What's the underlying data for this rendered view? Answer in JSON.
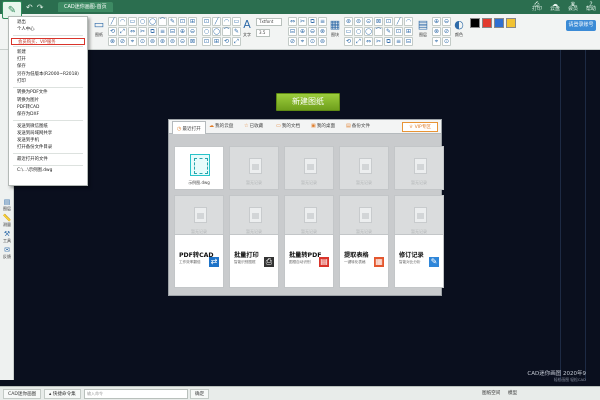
{
  "titlebar": {
    "tab_title": "CAD迷你画图-首页",
    "right_items": [
      {
        "icon": "print-icon",
        "label": "打印"
      },
      {
        "icon": "cloud-icon",
        "label": "云盘"
      },
      {
        "icon": "gift-icon",
        "label": "会员"
      },
      {
        "icon": "help-icon",
        "label": "帮助"
      }
    ],
    "login_label": "请登录账号"
  },
  "toolbar": {
    "font_label": "Txtfont",
    "size_label": "3.5",
    "big_buttons": [
      {
        "glyph": "A",
        "label": "文字"
      },
      {
        "glyph": "▦",
        "label": "图块"
      },
      {
        "glyph": "▤",
        "label": "图层"
      },
      {
        "glyph": "◐",
        "label": "颜色"
      }
    ],
    "left_labels": [
      "图纸",
      "直线"
    ],
    "colors": [
      "#000000",
      "#e23b2e",
      "#2f6fd1",
      "#f1c232"
    ]
  },
  "sidebar": {
    "items": [
      {
        "icon": "layers-icon",
        "label": "图层"
      },
      {
        "icon": "ruler-icon",
        "label": "测量"
      },
      {
        "icon": "tools-icon",
        "label": "工具"
      },
      {
        "icon": "chat-icon",
        "label": "反馈"
      }
    ]
  },
  "menu": {
    "items": [
      {
        "label": "退出",
        "sep": false,
        "highlight": false
      },
      {
        "label": "个人中心",
        "sep": true,
        "highlight": false
      },
      {
        "label": "会员购买、VIP服务",
        "sep": true,
        "highlight": true
      },
      {
        "label": "新建",
        "sep": false,
        "highlight": false
      },
      {
        "label": "打开",
        "sep": false,
        "highlight": false
      },
      {
        "label": "保存",
        "sep": false,
        "highlight": false
      },
      {
        "label": "另存为低版本(R2000~R2018)",
        "sep": false,
        "highlight": false
      },
      {
        "label": "打印",
        "sep": true,
        "highlight": false
      },
      {
        "label": "转换为PDF文件",
        "sep": false,
        "highlight": false
      },
      {
        "label": "转换为图片",
        "sep": false,
        "highlight": false
      },
      {
        "label": "PDF转CAD",
        "sep": false,
        "highlight": false
      },
      {
        "label": "保存为DXF",
        "sep": true,
        "highlight": false
      },
      {
        "label": "发送到微信图纸",
        "sep": false,
        "highlight": false
      },
      {
        "label": "发送到局域网共享",
        "sep": false,
        "highlight": false
      },
      {
        "label": "发送到手机",
        "sep": false,
        "highlight": false
      },
      {
        "label": "打开备份文件目录",
        "sep": true,
        "highlight": false
      },
      {
        "label": "最近打开的文件",
        "sep": true,
        "highlight": false
      },
      {
        "label": "C:\\...\\示例图.dwg",
        "sep": false,
        "highlight": false
      }
    ]
  },
  "main": {
    "new_button": "新建图纸",
    "tabs": [
      {
        "label": "最近打开",
        "icon": "clock-icon"
      },
      {
        "label": "我的云盘",
        "icon": "cloud-icon"
      },
      {
        "label": "已收藏",
        "icon": "star-icon"
      },
      {
        "label": "我的文档",
        "icon": "folder-icon"
      },
      {
        "label": "我的桌面",
        "icon": "desktop-icon"
      },
      {
        "label": "备份文件",
        "icon": "backup-icon"
      }
    ],
    "vip_label": "VIP专区",
    "recent_caption": "示例图.dwg",
    "empty_caption": "暂无记录",
    "features": [
      {
        "title": "PDF转CAD",
        "subtitle": "工作效率翻倍",
        "icon": "pdf-convert-icon",
        "color": "#1e73c8"
      },
      {
        "title": "批量打印",
        "subtitle": "智能识别图框",
        "icon": "printer-icon",
        "color": "#333333"
      },
      {
        "title": "批量转PDF",
        "subtitle": "图框自动识别",
        "icon": "pdf-icon",
        "color": "#d9342b"
      },
      {
        "title": "提取表格",
        "subtitle": "一键转化表格",
        "icon": "table-icon",
        "color": "#e4572e"
      },
      {
        "title": "修订记录",
        "subtitle": "智能对比分析",
        "icon": "revision-icon",
        "color": "#2f86d9"
      }
    ]
  },
  "statusbar": {
    "app_tab": "CAD迷你画图",
    "cmd_tab": "快捷命令集",
    "cmd_placeholder": "输入命令",
    "cmd_button": "确定",
    "coords": "",
    "right_items": [
      "图纸空间",
      "模型"
    ],
    "watermark_title": "CAD迷你画图 2020年9",
    "watermark_sub": "轻松画图 轻松CAD"
  }
}
